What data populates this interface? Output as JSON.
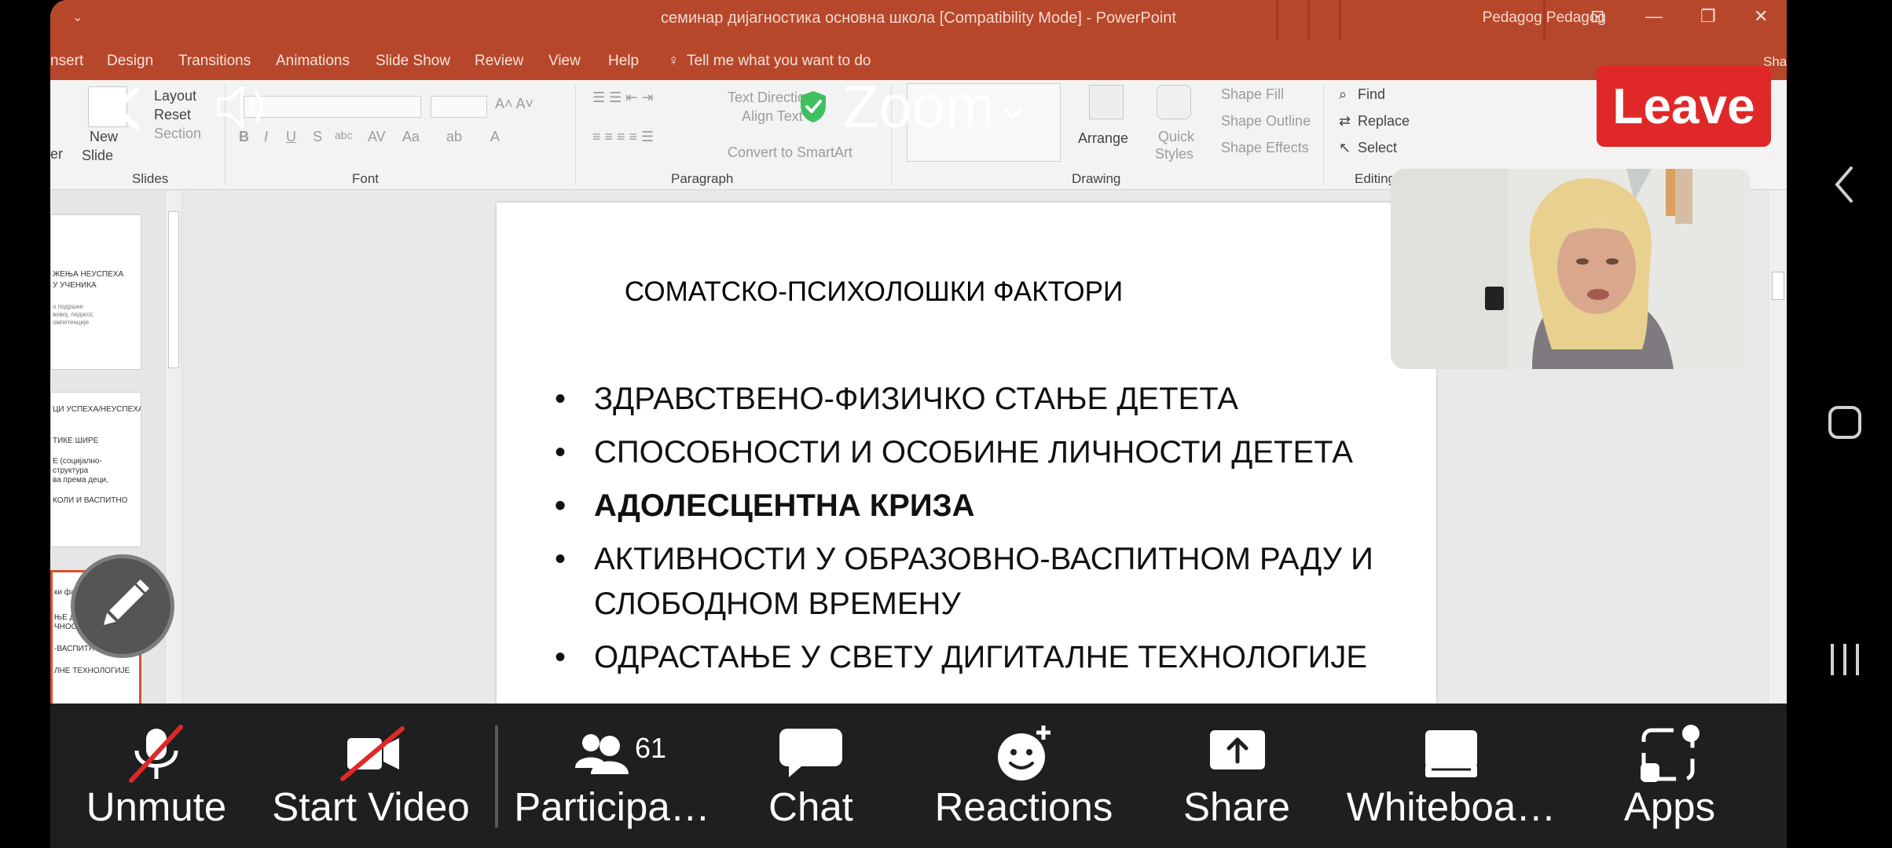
{
  "powerpoint": {
    "window_title": "семинар дијагностика основна школа [Compatibility Mode]  -  PowerPoint",
    "user": "Pedagog Pedagog",
    "tabs": [
      "nsert",
      "Design",
      "Transitions",
      "Animations",
      "Slide Show",
      "Review",
      "View",
      "Help"
    ],
    "tell_me": "Tell me what you want to do",
    "share": "Share",
    "ribbon": {
      "new_slide_1": "New",
      "new_slide_2": "Slide",
      "layout": "Layout",
      "reset": "Reset",
      "section": "Section",
      "text_direction": "Text Direction",
      "align_text": "Align Text",
      "convert": "Convert to SmartArt",
      "arrange": "Arrange",
      "quick_styles_1": "Quick",
      "quick_styles_2": "Styles",
      "shape_fill": "Shape Fill",
      "shape_outline": "Shape Outline",
      "shape_effects": "Shape Effects",
      "find": "Find",
      "replace": "Replace",
      "select": "Select",
      "groups": {
        "slides": "Slides",
        "font": "Font",
        "paragraph": "Paragraph",
        "drawing": "Drawing",
        "editing": "Editing"
      },
      "er_fragment": "er"
    },
    "thumbnails": [
      [
        "ЖЕЊА НЕУСПЕХА",
        "У УЧЕНИКА",
        "",
        "о подршке",
        "вовој, педагог,",
        "омпетенције"
      ],
      [
        "ЦИ УСПЕХА/НЕУСПЕХА У",
        "",
        "ТИКЕ ШИРЕ",
        "",
        "Е (социјално-",
        "структура",
        "ва према деци,",
        "",
        "КОЛИ И ВАСПИТНО"
      ],
      [
        "ки фактори",
        "",
        "ЊЕ ДЕТЕТА",
        "ЧНОСТИ ДЕТЕ",
        "",
        "-ВАСПИТНОМ РАДУ И",
        "",
        "ЛНЕ ТЕХНОЛОГИЈЕ"
      ]
    ],
    "slide": {
      "title": "СОМАТСКО-ПСИХОЛОШКИ ФАКТОРИ",
      "bullets": [
        "ЗДРАВСТВЕНО-ФИЗИЧКО СТАЊЕ ДЕТЕТА",
        "СПОСОБНОСТИ И ОСОБИНЕ ЛИЧНОСТИ ДЕТЕТА",
        "АДОЛЕСЦЕНТНА КРИЗА",
        "АКТИВНОСТИ У ОБРАЗОВНО-ВАСПИТНОМ РАДУ И СЛОБОДНОМ ВРЕМЕНУ",
        "ОДРАСТАЊЕ У СВЕТУ ДИГИТАЛНЕ ТЕХНОЛОГИЈЕ"
      ]
    }
  },
  "zoom": {
    "title": "Zoom",
    "leave": "Leave",
    "participant_count": "61",
    "toolbar": {
      "unmute": "Unmute",
      "start_video": "Start Video",
      "participants": "Participa…",
      "chat": "Chat",
      "reactions": "Reactions",
      "share": "Share",
      "whiteboard": "Whiteboa…",
      "apps": "Apps"
    }
  },
  "colors": {
    "ppt_red": "#b7472a",
    "leave_red": "#e02828",
    "shield_green": "#3fc05f",
    "toolbar_bg": "#1e1f20"
  }
}
